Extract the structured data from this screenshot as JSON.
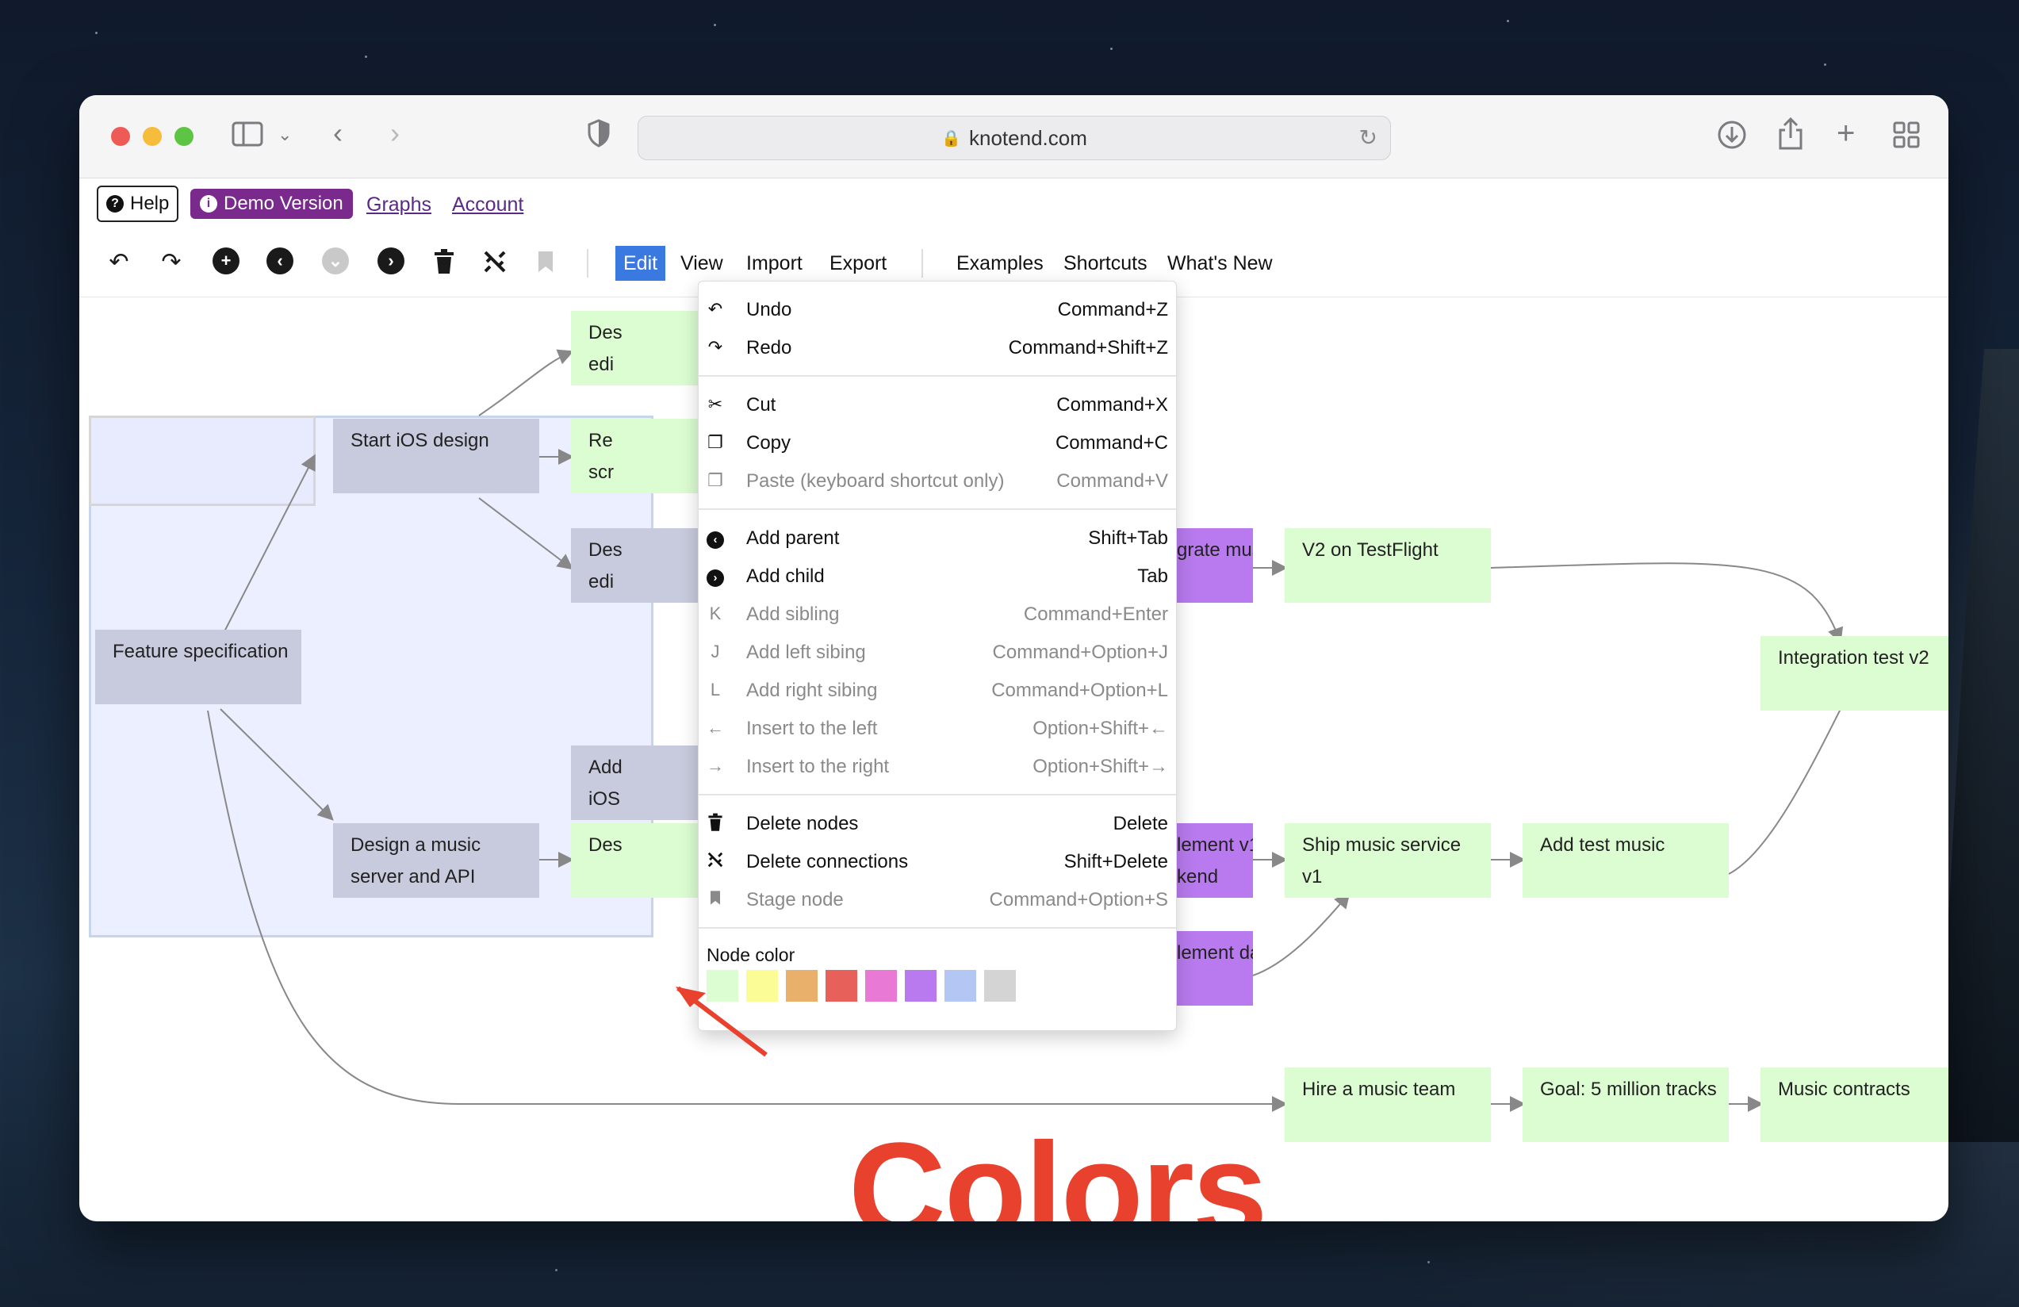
{
  "browser": {
    "url": "knotend.com"
  },
  "header": {
    "help_label": "Help",
    "demo_label": "Demo Version",
    "links": [
      "Graphs",
      "Account"
    ]
  },
  "menubar": {
    "items": [
      "Edit",
      "View",
      "Import",
      "Export"
    ],
    "right_items": [
      "Examples",
      "Shortcuts",
      "What's New"
    ]
  },
  "edit_menu": {
    "items": [
      {
        "label": "Undo",
        "shortcut": "Command+Z"
      },
      {
        "label": "Redo",
        "shortcut": "Command+Shift+Z"
      },
      {
        "label": "Cut",
        "shortcut": "Command+X"
      },
      {
        "label": "Copy",
        "shortcut": "Command+C"
      },
      {
        "label": "Paste (keyboard shortcut only)",
        "shortcut": "Command+V"
      },
      {
        "label": "Add parent",
        "shortcut": "Shift+Tab"
      },
      {
        "label": "Add child",
        "shortcut": "Tab"
      },
      {
        "label": "Add sibling",
        "shortcut": "Command+Enter",
        "key": "K"
      },
      {
        "label": "Add left sibing",
        "shortcut": "Command+Option+J",
        "key": "J"
      },
      {
        "label": "Add right sibing",
        "shortcut": "Command+Option+L",
        "key": "L"
      },
      {
        "label": "Insert to the left",
        "shortcut": "Option+Shift+←",
        "key": "←"
      },
      {
        "label": "Insert to the right",
        "shortcut": "Option+Shift+→",
        "key": "→"
      },
      {
        "label": "Delete nodes",
        "shortcut": "Delete"
      },
      {
        "label": "Delete connections",
        "shortcut": "Shift+Delete"
      },
      {
        "label": "Stage node",
        "shortcut": "Command+Option+S"
      }
    ],
    "node_color_label": "Node color",
    "colors": [
      "#dcfcd2",
      "#fcfc96",
      "#e8b06a",
      "#e8605a",
      "#e87ad6",
      "#b87aee",
      "#b4c6f4",
      "#d4d4d4"
    ]
  },
  "nodes": {
    "feature_spec": "Feature specification",
    "start_ios": "Start iOS design",
    "design_music_1": "Design a music",
    "design_music_2": "server and API",
    "partial_des_1a": "Des",
    "partial_des_1b": "edi",
    "partial_re_a": "Re",
    "partial_re_b": "scr",
    "partial_des_2a": "Des",
    "partial_des_2b": "edi",
    "partial_add_a": "Add",
    "partial_add_b": "iOS",
    "partial_des_3": "Des",
    "integrate_api": "grate music API",
    "v2_testflight": "V2 on TestFlight",
    "integration_test": "Integration test v2",
    "implement_v1_a": "lement v1",
    "implement_v1_b": "kend",
    "ship_music_a": "Ship music service",
    "ship_music_b": "v1",
    "add_test_music": "Add test music",
    "implement_db": "lement database",
    "hire_team": "Hire a music team",
    "goal_tracks": "Goal: 5 million tracks",
    "music_contracts": "Music contracts"
  },
  "annotation": "Colors"
}
